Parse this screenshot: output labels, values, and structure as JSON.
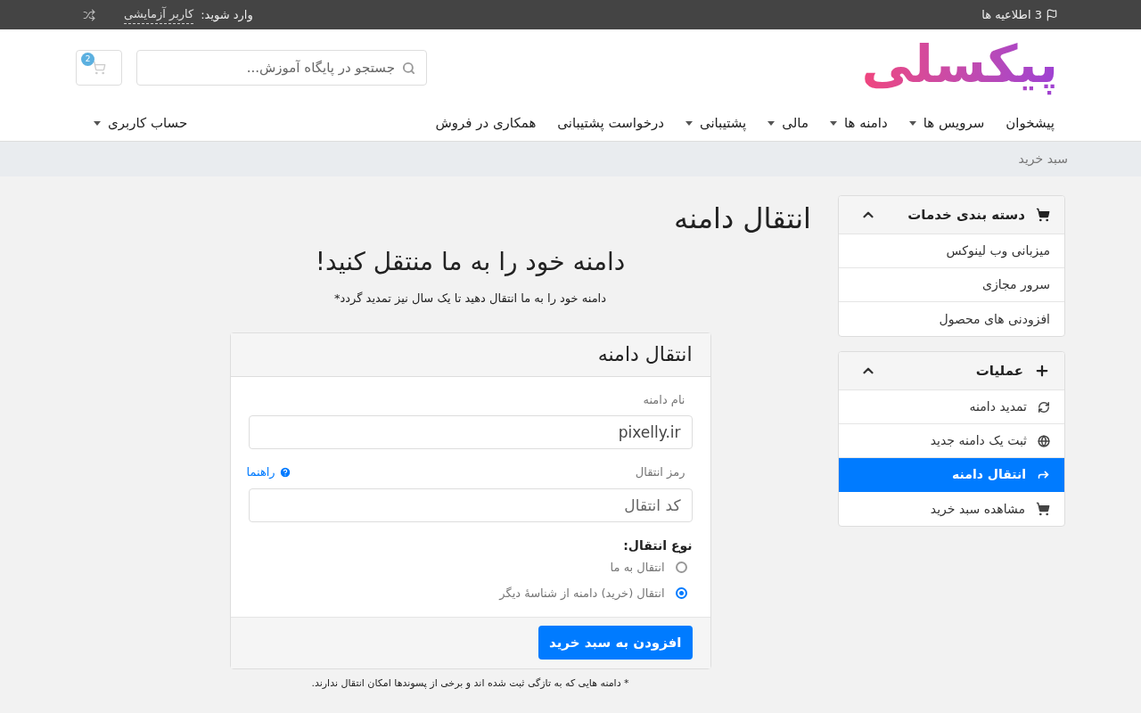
{
  "top_bar": {
    "notifications": "3 اطلاعیه ها",
    "login_label": "وارد شوید:",
    "user": "کاربر آزمایشی"
  },
  "header": {
    "logo": "پیکسلی",
    "search": {
      "placeholder": "جستجو در پایگاه آموزش..."
    },
    "cart_count": "2"
  },
  "nav": {
    "items": [
      {
        "label": "پیشخوان",
        "has_menu": false
      },
      {
        "label": "سرویس ها",
        "has_menu": true
      },
      {
        "label": "دامنه ها",
        "has_menu": true
      },
      {
        "label": "مالی",
        "has_menu": true
      },
      {
        "label": "پشتیبانی",
        "has_menu": true
      },
      {
        "label": "درخواست پشتیبانی",
        "has_menu": false
      },
      {
        "label": "همکاری در فروش",
        "has_menu": false
      }
    ],
    "account": {
      "label": "حساب کاربری",
      "has_menu": true
    }
  },
  "breadcrumb": "سبد خرید",
  "sidebar": {
    "panels": [
      {
        "title": "دسته بندی خدمات",
        "expanded": true,
        "items": [
          {
            "label": "میزبانی وب لینوکس",
            "selected": false
          },
          {
            "label": "سرور مجازی",
            "selected": false
          },
          {
            "label": "افزودنی های محصول",
            "selected": false
          }
        ]
      },
      {
        "title": "عملیات",
        "expanded": true,
        "items": [
          {
            "label": "تمدید دامنه",
            "selected": false
          },
          {
            "label": "ثبت یک دامنه جدید",
            "selected": false
          },
          {
            "label": "انتقال دامنه",
            "selected": true
          },
          {
            "label": "مشاهده سبد خرید",
            "selected": false
          }
        ]
      }
    ]
  },
  "main": {
    "title": "انتقال دامنه",
    "headline": "دامنه خود را به ما منتقل کنید!",
    "subtitle": "دامنه خود را به ما انتقال دهید تا یک سال نیز تمدید گردد*",
    "card": {
      "title": "انتقال دامنه",
      "domain_field": {
        "label": "نام دامنه",
        "value": "pixelly.ir"
      },
      "code_field": {
        "label": "رمز انتقال",
        "help": "راهنما",
        "placeholder": "کد انتقال"
      },
      "transfer_type": {
        "label": "نوع انتقال:",
        "options": [
          {
            "label": "انتقال به ما",
            "selected": false
          },
          {
            "label": "انتقال (خرید) دامنه از شناسهٔ دیگر",
            "selected": true
          }
        ]
      },
      "button": "افزودن به سبد خرید"
    },
    "footnote": "* دامنه هایی که به تازگی ثبت شده اند و برخی از پسوندها امکان انتقال ندارند."
  }
}
